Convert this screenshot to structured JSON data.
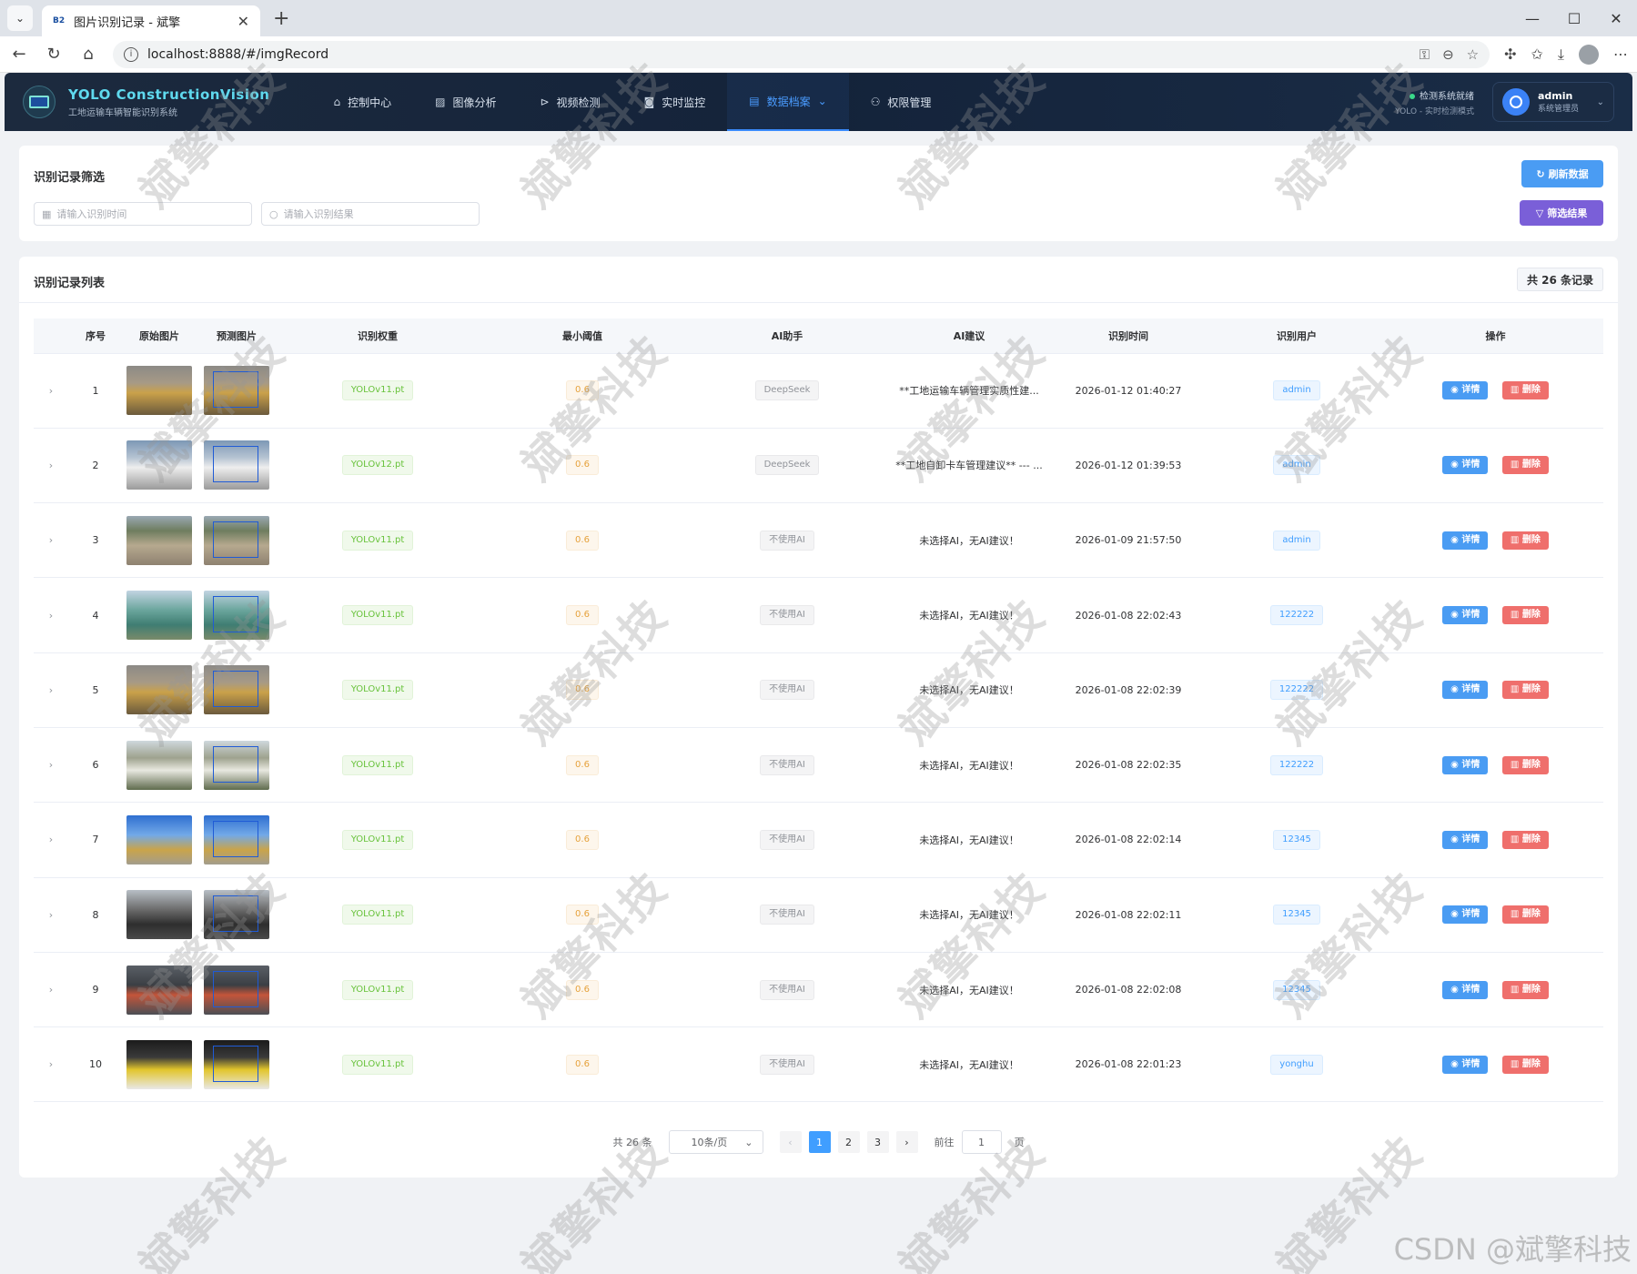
{
  "browser": {
    "tab_favicon": "B2",
    "tab_title": "图片识别记录 - 斌擎",
    "url": "localhost:8888/#/imgRecord"
  },
  "header": {
    "brand_name": "YOLO ConstructionVision",
    "brand_sub": "工地运输车辆智能识别系统",
    "menu": [
      {
        "label": "控制中心",
        "icon": "home-icon"
      },
      {
        "label": "图像分析",
        "icon": "image-icon"
      },
      {
        "label": "视频检测",
        "icon": "play-icon"
      },
      {
        "label": "实时监控",
        "icon": "camera-icon"
      },
      {
        "label": "数据档案",
        "icon": "document-icon",
        "active": true
      },
      {
        "label": "权限管理",
        "icon": "user-icon"
      }
    ],
    "status_line1": "检测系统就绪",
    "status_line2": "YOLO - 实时检测模式",
    "user_name": "admin",
    "user_role": "系统管理员"
  },
  "filter": {
    "title": "识别记录筛选",
    "time_placeholder": "请输入识别时间",
    "result_placeholder": "请输入识别结果",
    "refresh_label": "刷新数据",
    "filter_label": "筛选结果"
  },
  "list": {
    "title": "识别记录列表",
    "total_text": "共 26 条记录",
    "columns": [
      "",
      "序号",
      "原始图片",
      "预测图片",
      "识别权重",
      "最小阈值",
      "AI助手",
      "AI建议",
      "识别时间",
      "识别用户",
      "操作"
    ],
    "detail_label": "详情",
    "delete_label": "删除",
    "rows": [
      {
        "no": "1",
        "weight": "YOLOv11.pt",
        "threshold": "0.6",
        "ai": "DeepSeek",
        "advice": "**工地运输车辆管理实质性建...",
        "time": "2026-01-12 01:40:27",
        "user": "admin",
        "img": "loader-dirt"
      },
      {
        "no": "2",
        "weight": "YOLOv12.pt",
        "threshold": "0.6",
        "ai": "DeepSeek",
        "advice": "**工地自卸卡车管理建议** --- ...",
        "time": "2026-01-12 01:39:53",
        "user": "admin",
        "img": "tanker-truck"
      },
      {
        "no": "3",
        "weight": "YOLOv11.pt",
        "threshold": "0.6",
        "ai": "不使用AI",
        "advice": "未选择AI，无AI建议！",
        "time": "2026-01-09 21:57:50",
        "user": "admin",
        "img": "dirt-field"
      },
      {
        "no": "4",
        "weight": "YOLOv11.pt",
        "threshold": "0.6",
        "ai": "不使用AI",
        "advice": "未选择AI，无AI建议！",
        "time": "2026-01-08 22:02:43",
        "user": "122222",
        "img": "dump-truck-green"
      },
      {
        "no": "5",
        "weight": "YOLOv11.pt",
        "threshold": "0.6",
        "ai": "不使用AI",
        "advice": "未选择AI，无AI建议！",
        "time": "2026-01-08 22:02:39",
        "user": "122222",
        "img": "loader-dirt"
      },
      {
        "no": "6",
        "weight": "YOLOv11.pt",
        "threshold": "0.6",
        "ai": "不使用AI",
        "advice": "未选择AI，无AI建议！",
        "time": "2026-01-08 22:02:35",
        "user": "122222",
        "img": "white-truck"
      },
      {
        "no": "7",
        "weight": "YOLOv11.pt",
        "threshold": "0.6",
        "ai": "不使用AI",
        "advice": "未选择AI，无AI建议！",
        "time": "2026-01-08 22:02:14",
        "user": "12345",
        "img": "loader-sky"
      },
      {
        "no": "8",
        "weight": "YOLOv11.pt",
        "threshold": "0.6",
        "ai": "不使用AI",
        "advice": "未选择AI，无AI建议！",
        "time": "2026-01-08 22:02:11",
        "user": "12345",
        "img": "excavator-rubble"
      },
      {
        "no": "9",
        "weight": "YOLOv11.pt",
        "threshold": "0.6",
        "ai": "不使用AI",
        "advice": "未选择AI，无AI建议！",
        "time": "2026-01-08 22:02:08",
        "user": "12345",
        "img": "loader-red"
      },
      {
        "no": "10",
        "weight": "YOLOv11.pt",
        "threshold": "0.6",
        "ai": "不使用AI",
        "advice": "未选择AI，无AI建议！",
        "time": "2026-01-08 22:01:23",
        "user": "yonghu",
        "img": "loaders-yellow"
      }
    ]
  },
  "pagination": {
    "total_text": "共 26 条",
    "page_size": "10条/页",
    "pages": [
      "1",
      "2",
      "3"
    ],
    "current": "1",
    "goto_label": "前往",
    "goto_value": "1",
    "page_suffix": "页"
  },
  "watermark_text": "斌擎科技",
  "footer_watermark": "CSDN @斌擎科技"
}
